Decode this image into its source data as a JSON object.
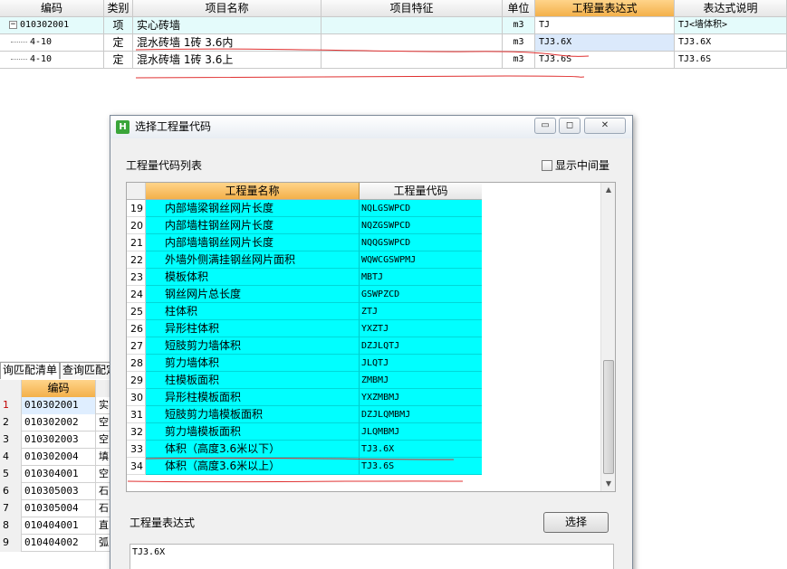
{
  "top_grid": {
    "headers": {
      "code": "编码",
      "type": "类别",
      "name": "项目名称",
      "feature": "项目特征",
      "unit": "单位",
      "expression": "工程量表达式",
      "description": "表达式说明"
    },
    "rows": [
      {
        "code": "010302001",
        "type": "项",
        "name": "实心砖墙",
        "feature": "",
        "unit": "m3",
        "expression": "TJ",
        "description": "TJ<墙体积>"
      },
      {
        "code": "4-10",
        "type": "定",
        "name": "混水砖墙 1砖 3.6内",
        "feature": "",
        "unit": "m3",
        "expression": "TJ3.6X",
        "description": "TJ3.6X"
      },
      {
        "code": "4-10",
        "type": "定",
        "name": "混水砖墙 1砖 3.6上",
        "feature": "",
        "unit": "m3",
        "expression": "TJ3.6S",
        "description": "TJ3.6S"
      }
    ],
    "expand_symbol": "−"
  },
  "query_panel": {
    "tabs": [
      "询匹配清单",
      "查询匹配定额"
    ],
    "header_code": "编码",
    "rows": [
      {
        "num": "1",
        "code": "010302001",
        "name": "实"
      },
      {
        "num": "2",
        "code": "010302002",
        "name": "空"
      },
      {
        "num": "3",
        "code": "010302003",
        "name": "空"
      },
      {
        "num": "4",
        "code": "010302004",
        "name": "填"
      },
      {
        "num": "5",
        "code": "010304001",
        "name": "空"
      },
      {
        "num": "6",
        "code": "010305003",
        "name": "石"
      },
      {
        "num": "7",
        "code": "010305004",
        "name": "石"
      },
      {
        "num": "8",
        "code": "010404001",
        "name": "直"
      },
      {
        "num": "9",
        "code": "010404002",
        "name": "弧"
      }
    ]
  },
  "dialog": {
    "title": "选择工程量代码",
    "app_icon_glyph": "H",
    "minimize_glyph": "▭",
    "maximize_glyph": "◻",
    "close_glyph": "✕",
    "list_label": "工程量代码列表",
    "show_intermediate_label": "显示中间量",
    "show_intermediate_checked": false,
    "list_headers": {
      "name": "工程量名称",
      "code": "工程量代码"
    },
    "list_rows": [
      {
        "num": "19",
        "name": "内部墙梁钢丝网片长度",
        "code": "NQLGSWPCD"
      },
      {
        "num": "20",
        "name": "内部墙柱钢丝网片长度",
        "code": "NQZGSWPCD"
      },
      {
        "num": "21",
        "name": "内部墙墙钢丝网片长度",
        "code": "NQQGSWPCD"
      },
      {
        "num": "22",
        "name": "外墙外侧满挂钢丝网片面积",
        "code": "WQWCGSWPMJ"
      },
      {
        "num": "23",
        "name": "模板体积",
        "code": "MBTJ"
      },
      {
        "num": "24",
        "name": "钢丝网片总长度",
        "code": "GSWPZCD"
      },
      {
        "num": "25",
        "name": "柱体积",
        "code": "ZTJ"
      },
      {
        "num": "26",
        "name": "异形柱体积",
        "code": "YXZTJ"
      },
      {
        "num": "27",
        "name": "短肢剪力墙体积",
        "code": "DZJLQTJ"
      },
      {
        "num": "28",
        "name": "剪力墙体积",
        "code": "JLQTJ"
      },
      {
        "num": "29",
        "name": "柱模板面积",
        "code": "ZMBMJ"
      },
      {
        "num": "30",
        "name": "异形柱模板面积",
        "code": "YXZMBMJ"
      },
      {
        "num": "31",
        "name": "短肢剪力墙模板面积",
        "code": "DZJLQMBMJ"
      },
      {
        "num": "32",
        "name": "剪力墙模板面积",
        "code": "JLQMBMJ"
      },
      {
        "num": "33",
        "name": "体积（高度3.6米以下）",
        "code": "TJ3.6X"
      },
      {
        "num": "34",
        "name": "体积（高度3.6米以上）",
        "code": "TJ3.6S"
      }
    ],
    "scroll_up_glyph": "▲",
    "scroll_down_glyph": "▼",
    "expression_label": "工程量表达式",
    "select_button": "选择",
    "expression_value": "TJ3.6X"
  }
}
